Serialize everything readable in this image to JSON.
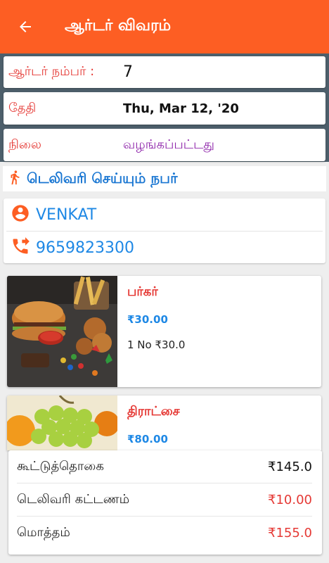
{
  "appbar": {
    "title": "ஆர்டர் விவரம்",
    "back_icon": "arrow-back-icon"
  },
  "order": {
    "number_label": "ஆர்டர் நம்பர் :",
    "number_value": "7",
    "date_label": "தேதி",
    "date_value": "Thu, Mar 12, '20",
    "status_label": "நிலை",
    "status_value": "வழங்கப்பட்டது"
  },
  "delivery": {
    "heading": "டெலிவரி செய்யும் நபர்",
    "name": "VENKAT",
    "phone": "9659823300"
  },
  "items": [
    {
      "name": "பர்கர்",
      "price": "₹30.00",
      "qty": "1 No ₹30.0"
    },
    {
      "name": "திராட்சை",
      "price": "₹80.00",
      "qty": ""
    }
  ],
  "totals": {
    "subtotal_label": "கூட்டுத்தொகை",
    "subtotal_value": "₹145.0",
    "delivery_label": "டெலிவரி கட்டணம்",
    "delivery_value": "₹10.00",
    "total_label": "மொத்தம்",
    "total_value": "₹155.0"
  },
  "colors": {
    "primary": "#fd5e23",
    "label_red": "#e53935",
    "link_blue": "#1e88e5",
    "status_purple": "#8e24aa",
    "panel_bg": "#4d5f6b"
  }
}
